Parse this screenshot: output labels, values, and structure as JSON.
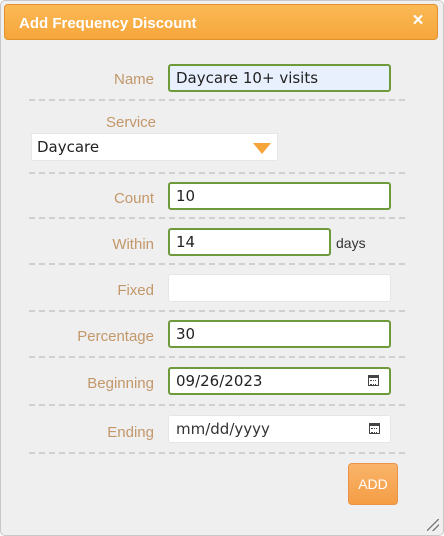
{
  "dialog": {
    "title": "Add Frequency Discount",
    "close_glyph": "×"
  },
  "form": {
    "name_label": "Name",
    "name_value": "Daycare 10+ visits",
    "service_label": "Service",
    "service_value": "Daycare",
    "count_label": "Count",
    "count_value": "10",
    "within_label": "Within",
    "within_value": "14",
    "within_unit": "days",
    "fixed_label": "Fixed",
    "fixed_value": "",
    "percentage_label": "Percentage",
    "percentage_value": "30",
    "beginning_label": "Beginning",
    "beginning_value": "09/26/2023",
    "ending_label": "Ending",
    "ending_placeholder": "mm/dd/yyyy"
  },
  "actions": {
    "add_label": "ADD"
  },
  "colors": {
    "title_bar": "#f6a63c",
    "field_border": "#6f9a3c",
    "label_text": "#c3976a",
    "add_button": "#f59d45"
  },
  "icons": [
    "close-icon",
    "dropdown-caret-icon",
    "calendar-icon",
    "resize-grip-icon"
  ]
}
